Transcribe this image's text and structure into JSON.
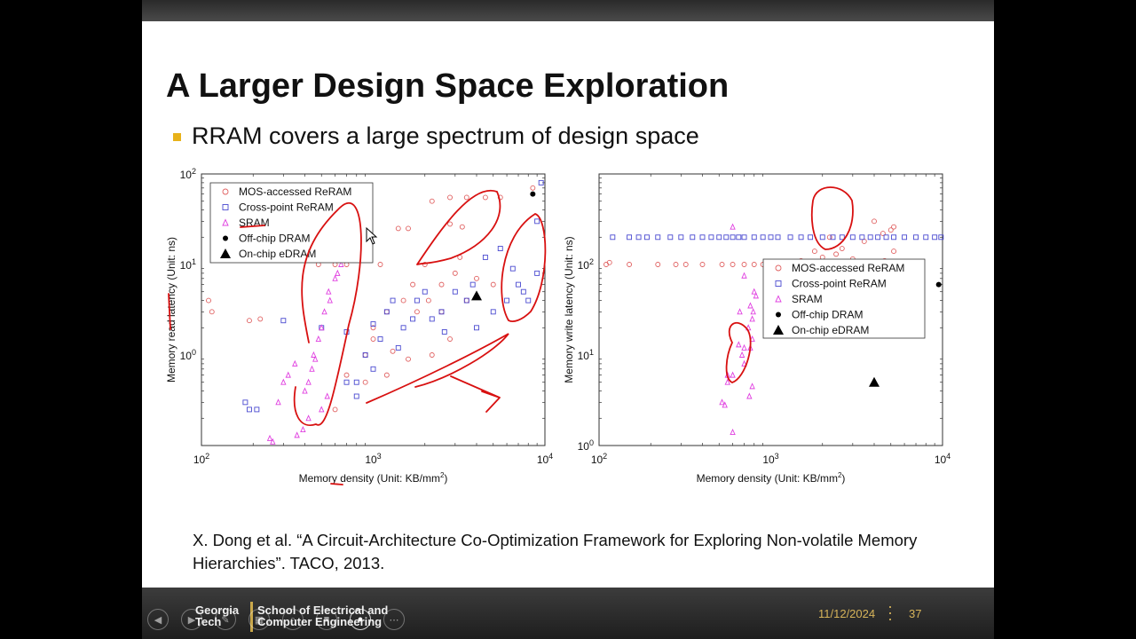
{
  "slide": {
    "title": "A Larger Design Space Exploration",
    "bullet": "RRAM covers a large spectrum of design space",
    "citation": "X. Dong et al. “A Circuit-Architecture Co-Optimization Framework for Exploring Non-volatile Memory Hierarchies”.  TACO, 2013."
  },
  "footer": {
    "logo_line1": "Georgia",
    "logo_line2": "Tech",
    "school_line1": "School of Electrical and",
    "school_line2": "Computer Engineering",
    "date": "11/12/2024",
    "page": "37"
  },
  "colors": {
    "mos": "#e06060",
    "xpoint": "#4a4ad0",
    "sram": "#e040e0",
    "ink": "#d81010",
    "accent": "#e8b21a"
  },
  "chart_data": [
    {
      "type": "scatter",
      "xlabel": "Memory density (Unit: KB/mm2)",
      "ylabel": "Memory read latency (Unit: ns)",
      "xscale": "log",
      "yscale": "log",
      "xlim": [
        100,
        10000
      ],
      "ylim": [
        0.1,
        100
      ],
      "xticks": [
        "10^2",
        "10^3",
        "10^4"
      ],
      "yticks": [
        "10^2",
        "10^1",
        "10^0"
      ],
      "legend_position": "top-left",
      "series": [
        {
          "name": "MOS-accessed ReRAM",
          "marker": "circle",
          "points": [
            [
              110,
              4
            ],
            [
              115,
              3
            ],
            [
              190,
              2.4
            ],
            [
              220,
              2.5
            ],
            [
              480,
              10
            ],
            [
              600,
              10
            ],
            [
              700,
              10
            ],
            [
              1100,
              10
            ],
            [
              1400,
              25
            ],
            [
              1600,
              25
            ],
            [
              2200,
              50
            ],
            [
              2800,
              55
            ],
            [
              3500,
              55
            ],
            [
              4500,
              55
            ],
            [
              5500,
              55
            ],
            [
              8500,
              70
            ],
            [
              2000,
              10
            ],
            [
              2500,
              6
            ],
            [
              3000,
              8
            ],
            [
              1500,
              4
            ],
            [
              1800,
              3
            ],
            [
              2500,
              3
            ],
            [
              3500,
              4
            ],
            [
              1000,
              1.5
            ],
            [
              1300,
              1.1
            ],
            [
              1600,
              0.9
            ],
            [
              2200,
              1
            ],
            [
              2800,
              1.5
            ],
            [
              700,
              0.6
            ],
            [
              900,
              0.5
            ],
            [
              1200,
              0.6
            ],
            [
              600,
              0.25
            ],
            [
              1000,
              2
            ],
            [
              3200,
              12
            ],
            [
              4000,
              7
            ],
            [
              5000,
              6
            ],
            [
              2800,
              28
            ],
            [
              3300,
              26
            ],
            [
              1700,
              6
            ],
            [
              2100,
              4
            ],
            [
              900,
              1
            ],
            [
              1200,
              3
            ]
          ]
        },
        {
          "name": "Cross-point ReRAM",
          "marker": "square",
          "points": [
            [
              180,
              0.3
            ],
            [
              190,
              0.25
            ],
            [
              210,
              0.25
            ],
            [
              300,
              2.4
            ],
            [
              500,
              2
            ],
            [
              700,
              1.8
            ],
            [
              800,
              0.5
            ],
            [
              900,
              1
            ],
            [
              1000,
              0.7
            ],
            [
              1200,
              3
            ],
            [
              1500,
              2
            ],
            [
              1800,
              4
            ],
            [
              2000,
              5
            ],
            [
              2500,
              3
            ],
            [
              3000,
              5
            ],
            [
              3500,
              4
            ],
            [
              4000,
              2
            ],
            [
              5000,
              3
            ],
            [
              6000,
              4
            ],
            [
              7000,
              6
            ],
            [
              8000,
              4
            ],
            [
              9000,
              30
            ],
            [
              9500,
              80
            ],
            [
              9000,
              8
            ],
            [
              700,
              0.5
            ],
            [
              1000,
              2.2
            ],
            [
              1100,
              1.5
            ],
            [
              1400,
              1.2
            ],
            [
              2200,
              2.5
            ],
            [
              2600,
              1.8
            ],
            [
              3800,
              6
            ],
            [
              4500,
              12
            ],
            [
              5500,
              15
            ],
            [
              6500,
              9
            ],
            [
              7500,
              5
            ],
            [
              800,
              0.35
            ],
            [
              1300,
              4
            ],
            [
              1700,
              2.5
            ]
          ]
        },
        {
          "name": "SRAM",
          "marker": "triangle",
          "points": [
            [
              250,
              0.12
            ],
            [
              280,
              0.3
            ],
            [
              300,
              0.5
            ],
            [
              320,
              0.6
            ],
            [
              350,
              0.8
            ],
            [
              400,
              0.4
            ],
            [
              420,
              0.5
            ],
            [
              440,
              0.7
            ],
            [
              450,
              1
            ],
            [
              480,
              1.5
            ],
            [
              500,
              2
            ],
            [
              520,
              3
            ],
            [
              550,
              5
            ],
            [
              600,
              7
            ],
            [
              650,
              10
            ],
            [
              620,
              8
            ],
            [
              560,
              4
            ],
            [
              420,
              0.2
            ],
            [
              390,
              0.15
            ],
            [
              360,
              0.13
            ],
            [
              260,
              0.11
            ],
            [
              500,
              0.25
            ],
            [
              540,
              0.35
            ],
            [
              460,
              0.9
            ]
          ]
        },
        {
          "name": "Off-chip DRAM",
          "marker": "dot",
          "points": [
            [
              8500,
              60
            ]
          ]
        },
        {
          "name": "On-chip eDRAM",
          "marker": "filled-triangle",
          "points": [
            [
              4000,
              4.5
            ]
          ]
        }
      ]
    },
    {
      "type": "scatter",
      "xlabel": "Memory density (Unit: KB/mm2)",
      "ylabel": "Memory write latency (Unit: ns)",
      "xscale": "log",
      "yscale": "log",
      "xlim": [
        100,
        10000
      ],
      "ylim": [
        1,
        1000
      ],
      "xticks": [
        "10^2",
        "10^3",
        "10^4"
      ],
      "yticks": [
        "10^2",
        "10^1",
        "10^0"
      ],
      "legend_position": "center-right",
      "series": [
        {
          "name": "MOS-accessed ReRAM",
          "marker": "circle",
          "points": [
            [
              110,
              100
            ],
            [
              115,
              105
            ],
            [
              150,
              100
            ],
            [
              220,
              100
            ],
            [
              280,
              100
            ],
            [
              320,
              100
            ],
            [
              400,
              100
            ],
            [
              520,
              100
            ],
            [
              600,
              100
            ],
            [
              700,
              100
            ],
            [
              800,
              100
            ],
            [
              900,
              100
            ],
            [
              1000,
              100
            ],
            [
              1200,
              100
            ],
            [
              1400,
              100
            ],
            [
              1600,
              100
            ],
            [
              1800,
              100
            ],
            [
              2000,
              100
            ],
            [
              2200,
              100
            ],
            [
              2500,
              100
            ],
            [
              2800,
              100
            ],
            [
              3200,
              100
            ],
            [
              3700,
              100
            ],
            [
              4200,
              100
            ],
            [
              4800,
              100
            ],
            [
              5200,
              105
            ],
            [
              1500,
              110
            ],
            [
              2000,
              120
            ],
            [
              2400,
              130
            ],
            [
              2600,
              150
            ],
            [
              3500,
              180
            ],
            [
              4500,
              220
            ],
            [
              5000,
              240
            ],
            [
              5200,
              260
            ],
            [
              4000,
              300
            ],
            [
              2200,
              200
            ],
            [
              1800,
              140
            ],
            [
              3000,
              115
            ],
            [
              4600,
              110
            ],
            [
              5200,
              140
            ],
            [
              1900,
              105
            ],
            [
              2700,
              102
            ]
          ]
        },
        {
          "name": "Cross-point ReRAM",
          "marker": "square",
          "points": [
            [
              120,
              200
            ],
            [
              150,
              200
            ],
            [
              170,
              200
            ],
            [
              190,
              200
            ],
            [
              220,
              200
            ],
            [
              260,
              200
            ],
            [
              300,
              200
            ],
            [
              350,
              200
            ],
            [
              400,
              200
            ],
            [
              450,
              200
            ],
            [
              500,
              200
            ],
            [
              550,
              200
            ],
            [
              600,
              200
            ],
            [
              650,
              200
            ],
            [
              700,
              200
            ],
            [
              800,
              200
            ],
            [
              900,
              200
            ],
            [
              1000,
              200
            ],
            [
              1100,
              200
            ],
            [
              1300,
              200
            ],
            [
              1500,
              200
            ],
            [
              1700,
              200
            ],
            [
              2000,
              200
            ],
            [
              2300,
              200
            ],
            [
              2600,
              200
            ],
            [
              3000,
              200
            ],
            [
              3400,
              200
            ],
            [
              3800,
              200
            ],
            [
              4200,
              200
            ],
            [
              4700,
              200
            ],
            [
              5200,
              200
            ],
            [
              6000,
              200
            ],
            [
              7000,
              200
            ],
            [
              8000,
              200
            ],
            [
              9000,
              200
            ],
            [
              9800,
              200
            ]
          ]
        },
        {
          "name": "SRAM",
          "marker": "triangle",
          "points": [
            [
              520,
              3
            ],
            [
              560,
              5
            ],
            [
              600,
              6
            ],
            [
              650,
              13
            ],
            [
              700,
              8
            ],
            [
              760,
              12
            ],
            [
              780,
              15
            ],
            [
              790,
              30
            ],
            [
              800,
              50
            ],
            [
              820,
              45
            ],
            [
              780,
              25
            ],
            [
              740,
              20
            ],
            [
              700,
              12
            ],
            [
              680,
              10
            ],
            [
              560,
              6
            ],
            [
              600,
              1.4
            ],
            [
              750,
              3.5
            ],
            [
              780,
              4.5
            ],
            [
              540,
              2.8
            ],
            [
              700,
              75
            ],
            [
              600,
              260
            ],
            [
              660,
              30
            ],
            [
              760,
              35
            ]
          ]
        },
        {
          "name": "Off-chip DRAM",
          "marker": "dot",
          "points": [
            [
              9500,
              60
            ]
          ]
        },
        {
          "name": "On-chip eDRAM",
          "marker": "filled-triangle",
          "points": [
            [
              4000,
              5
            ]
          ]
        }
      ]
    }
  ]
}
